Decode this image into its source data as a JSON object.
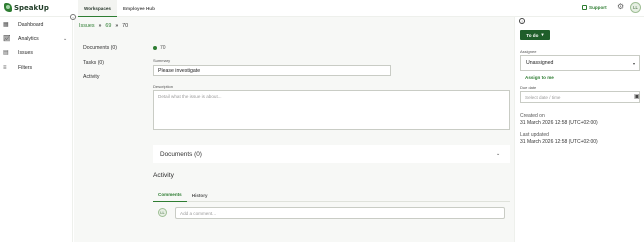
{
  "app": {
    "name": "SpeakUp"
  },
  "topnav": {
    "tabs": [
      "Workspaces",
      "Employee Hub"
    ],
    "active": "Workspaces"
  },
  "topright": {
    "support_label": "Support",
    "avatar_initials": "LL"
  },
  "sidebar": {
    "items": [
      {
        "label": "Dashboard",
        "icon": "grid-icon"
      },
      {
        "label": "Analytics",
        "icon": "chart-icon",
        "expandable": true
      },
      {
        "label": "Issues",
        "icon": "issues-icon"
      },
      {
        "label": "Filters",
        "icon": "filter-icon"
      }
    ]
  },
  "breadcrumb": {
    "root": "Issues",
    "parent": "69",
    "current": "70"
  },
  "leftnav": {
    "documents": "Documents (0)",
    "tasks": "Tasks (0)",
    "activity": "Activity"
  },
  "issue": {
    "status_number": "70",
    "summary_label": "Summary",
    "summary_value": "Please investigate",
    "description_label": "Description",
    "description_placeholder": "Detail what the issue is about..."
  },
  "documents_card": {
    "title": "Documents (0)"
  },
  "activity": {
    "heading": "Activity",
    "tabs": [
      "Comments",
      "History"
    ],
    "active_tab": "Comments",
    "comment_placeholder": "Add a comment...",
    "avatar_initials": "LL"
  },
  "rightpanel": {
    "status_button": "To do",
    "assignee_label": "Assignee",
    "assignee_value": "Unassigned",
    "assign_me": "Assign to me",
    "due_label": "Due date",
    "due_placeholder": "Select date / time",
    "created_label": "Created on",
    "created_value": "31 March 2026 12:58 (UTC+02:00)",
    "updated_label": "Last updated",
    "updated_value": "31 March 2026 12:58 (UTC+02:00)"
  },
  "colors": {
    "accent": "#2e7d32",
    "button": "#1f5e2a"
  }
}
